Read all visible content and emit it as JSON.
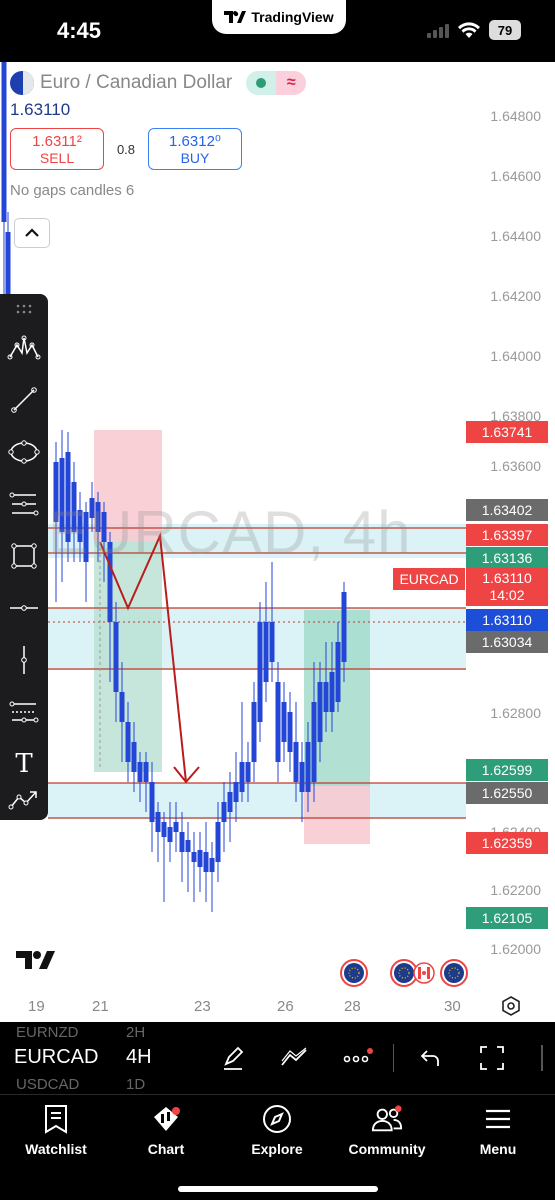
{
  "status_bar": {
    "time": "4:45",
    "app_pill": "TradingView",
    "battery": "79"
  },
  "symbol": {
    "name": "Euro / Canadian Dollar",
    "last_price": "1.63110",
    "sell_price": "1.6311²",
    "sell_label": "SELL",
    "spread": "0.8",
    "buy_price": "1.6312⁰",
    "buy_label": "BUY",
    "indicator": "No gaps candles 6",
    "watermark": "EURCAD, 4h"
  },
  "price_scale": [
    "1.64800",
    "1.64600",
    "1.64400",
    "1.64200",
    "1.64000",
    "1.63800",
    "1.63600",
    "1.62800",
    "1.62400",
    "1.62200",
    "1.62000"
  ],
  "price_labels": [
    {
      "text": "1.63741",
      "color": "#ef4444"
    },
    {
      "text": "1.63402",
      "color": "#6b6b6b"
    },
    {
      "text": "1.63397",
      "color": "#ef4444"
    },
    {
      "text": "1.63136",
      "color": "#2e9e7a"
    },
    {
      "text": "EURCAD",
      "color": "#ef4444"
    },
    {
      "text": "1.63110",
      "color": "#ef4444"
    },
    {
      "text": "14:02",
      "color": "#ef4444"
    },
    {
      "text": "1.63110",
      "color": "#1d4ed8"
    },
    {
      "text": "1.63034",
      "color": "#6b6b6b"
    },
    {
      "text": "1.62599",
      "color": "#2e9e7a"
    },
    {
      "text": "1.62550",
      "color": "#6b6b6b"
    },
    {
      "text": "1.62359",
      "color": "#ef4444"
    },
    {
      "text": "1.62105",
      "color": "#2e9e7a"
    }
  ],
  "time_axis": [
    "19",
    "21",
    "23",
    "26",
    "28",
    "30"
  ],
  "toolbar": {
    "tools": [
      "drag-handle-icon",
      "pattern-icon",
      "trendline-icon",
      "ellipse-icon",
      "fib-icon",
      "rectangle-icon",
      "horizontal-line-icon",
      "vertical-line-icon",
      "channel-icon",
      "text-icon",
      "path-icon"
    ]
  },
  "symbol_bar": {
    "current_symbol": "EURCAD",
    "current_timeframe": "4H",
    "prev_symbol": "EURNZD",
    "prev_timeframe": "2H",
    "next_symbol": "USDCAD",
    "next_timeframe": "1D"
  },
  "nav": {
    "watchlist": "Watchlist",
    "chart": "Chart",
    "explore": "Explore",
    "community": "Community",
    "menu": "Menu"
  }
}
